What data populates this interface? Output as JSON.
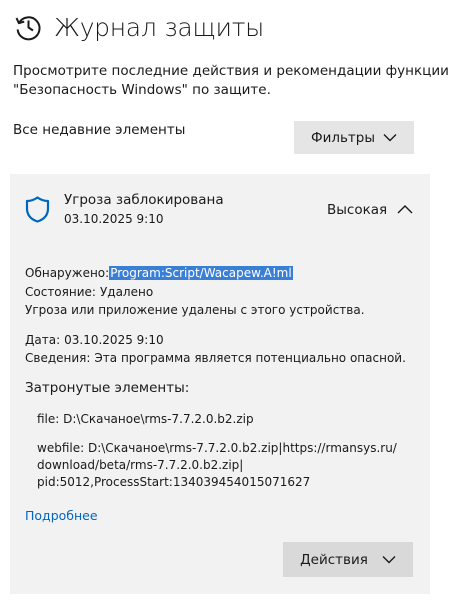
{
  "header": {
    "icon": "history-icon",
    "title": "Журнал защиты"
  },
  "description": "Просмотрите последние действия и рекомендации функции \"Безопасность Windows\" по защите.",
  "section_label": "Все недавние элементы",
  "filters_button": {
    "label": "Фильтры",
    "icon": "chevron-down-icon"
  },
  "threat_card": {
    "icon": "shield-icon",
    "title": "Угроза заблокирована",
    "date": "03.10.2025 9:10",
    "severity": "Высокая",
    "collapse_icon": "chevron-up-icon",
    "detected_label": "Обнаружено:",
    "detected_value": "Program:Script/Wacapew.A!ml",
    "status_label": "Состояние:",
    "status_value": "Удалено",
    "removed_note": "Угроза или приложение удалены с этого устройства.",
    "date_label": "Дата:",
    "date_value": "03.10.2025 9:10",
    "details_label": "Сведения:",
    "details_value": "Эта программа является потенциально опасной.",
    "affected_heading": "Затронутые элементы:",
    "affected_file": "file: D:\\Скачаное\\rms-7.7.2.0.b2.zip",
    "affected_webfile_1": "webfile: D:\\Скачаное\\rms-7.7.2.0.b2.zip|https://rmansys.ru/",
    "affected_webfile_2": "download/beta/rms-7.7.2.0.b2.zip|",
    "affected_webfile_3": "pid:5012,ProcessStart:134039454015071627",
    "more_link": "Подробнее",
    "actions_button": {
      "label": "Действия",
      "icon": "chevron-down-icon"
    }
  },
  "colors": {
    "accent": "#0067c0",
    "shield": "#0067c0",
    "selection": "#3a7fd6",
    "card_bg": "#f2f2f2",
    "button_bg": "#e5e5e5"
  }
}
